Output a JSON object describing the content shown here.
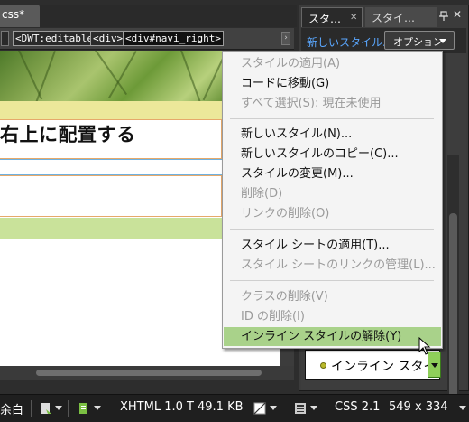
{
  "document": {
    "tab_title": "css*",
    "tags": [
      "<DWT:editable>",
      "<div>",
      "<div#navi_right>"
    ],
    "heading": "右上に配置する"
  },
  "status_bar": {
    "left_text": "余白",
    "doctype": "XHTML 1.0 T",
    "file_size": "49.1 KB",
    "css_version": "CSS 2.1",
    "dimensions": "549 x 334"
  },
  "panel": {
    "tab_active": "スタ…",
    "tab_inactive": "スタイ…",
    "new_style_link": "新しいスタイル...",
    "options_button": "オプション",
    "inline_style_field": "インライン スタイ"
  },
  "menu": {
    "items": [
      {
        "label": "スタイルの適用(A)",
        "enabled": false
      },
      {
        "label": "コードに移動(G)",
        "enabled": true
      },
      {
        "label": "すべて選択(S): 現在未使用",
        "enabled": false
      },
      {
        "label": "新しいスタイル(N)...",
        "enabled": true
      },
      {
        "label": "新しいスタイルのコピー(C)...",
        "enabled": true
      },
      {
        "label": "スタイルの変更(M)...",
        "enabled": true
      },
      {
        "label": "削除(D)",
        "enabled": false
      },
      {
        "label": "リンクの削除(O)",
        "enabled": false
      },
      {
        "label": "スタイル シートの適用(T)...",
        "enabled": true
      },
      {
        "label": "スタイル シートのリンクの管理(L)...",
        "enabled": false
      },
      {
        "label": "クラスの削除(V)",
        "enabled": false
      },
      {
        "label": "ID の削除(I)",
        "enabled": false
      },
      {
        "label": "インライン スタイルの解除(Y)",
        "enabled": true,
        "highlighted": true
      }
    ]
  },
  "colors": {
    "highlight": "#a9d28a",
    "link_blue": "#5aa7ff",
    "status_bg": "#1f1f1f"
  }
}
